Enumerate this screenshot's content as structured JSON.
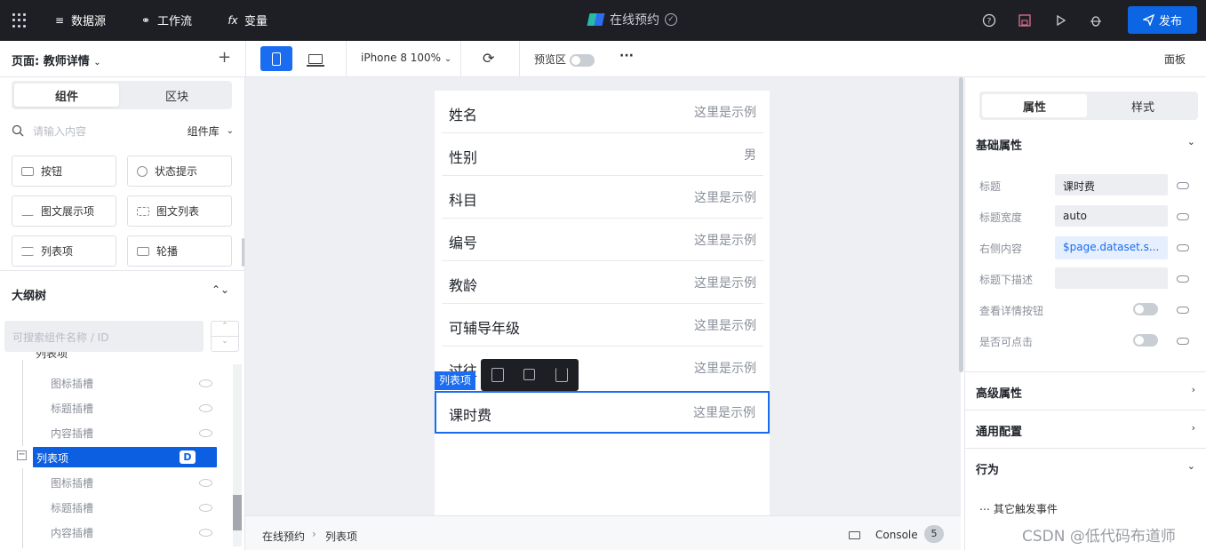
{
  "topbar": {
    "datasource": "数据源",
    "workflow": "工作流",
    "variable": "变量",
    "variable_icon": "fx",
    "app_title": "在线预约",
    "publish": "发布"
  },
  "toolbar": {
    "page_label": "页面: 教师详情",
    "device": "iPhone 8 100%",
    "preview": "预览区",
    "more": "···",
    "panel": "面板"
  },
  "left": {
    "tabs": [
      "组件",
      "区块"
    ],
    "search_placeholder": "请输入内容",
    "library": "组件库",
    "components": [
      "按钮",
      "状态提示",
      "图文展示项",
      "图文列表",
      "列表项",
      "轮播"
    ],
    "outline_title": "大纲树",
    "tree_search_placeholder": "可搜索组件名称 / ID",
    "tree": {
      "top_partial": "列表项",
      "group1": [
        "图标插槽",
        "标题插槽",
        "内容插槽"
      ],
      "selected": "列表项",
      "selected_badge": "D",
      "group2": [
        "图标插槽",
        "标题插槽",
        "内容插槽"
      ]
    }
  },
  "canvas": {
    "rows": [
      {
        "title": "姓名",
        "value": "这里是示例"
      },
      {
        "title": "性别",
        "value": "男"
      },
      {
        "title": "科目",
        "value": "这里是示例"
      },
      {
        "title": "编号",
        "value": "这里是示例"
      },
      {
        "title": "教龄",
        "value": "这里是示例"
      },
      {
        "title": "可辅导年级",
        "value": "这里是示例"
      },
      {
        "title": "过往",
        "value": "这里是示例"
      }
    ],
    "selected_row": {
      "title": "课时费",
      "value": "这里是示例"
    },
    "selected_tag": "列表项"
  },
  "bottom": {
    "breadcrumb": [
      "在线预约",
      "列表项"
    ],
    "console": "Console",
    "console_count": "5"
  },
  "right": {
    "tabs": [
      "属性",
      "样式"
    ],
    "basic": "基础属性",
    "props": [
      {
        "label": "标题",
        "value": "课时费"
      },
      {
        "label": "标题宽度",
        "value": "auto"
      },
      {
        "label": "右侧内容",
        "value": "$page.dataset.s..."
      },
      {
        "label": "标题下描述",
        "value": ""
      }
    ],
    "toggles": [
      "查看详情按钮",
      "是否可点击"
    ],
    "advanced": "高级属性",
    "common": "通用配置",
    "behavior": "行为",
    "other_events": "其它触发事件"
  },
  "watermark": "CSDN @低代码布道师"
}
